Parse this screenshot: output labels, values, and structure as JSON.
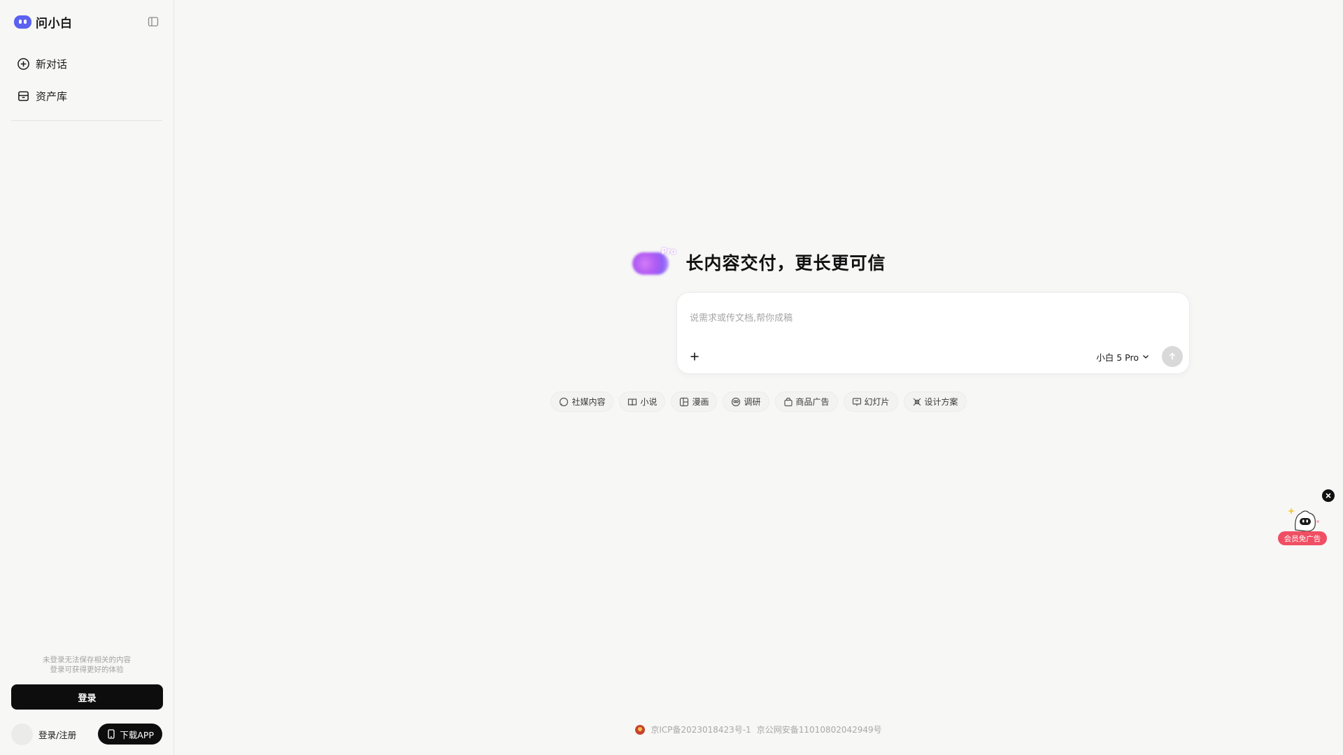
{
  "app": {
    "name": "问小白"
  },
  "sidebar": {
    "items": [
      {
        "label": "新对话",
        "icon": "plus-circle-icon"
      },
      {
        "label": "资产库",
        "icon": "archive-box-icon"
      }
    ],
    "hint_line1": "未登录无法保存相关的内容",
    "hint_line2": "登录可获得更好的体验",
    "login_label": "登录",
    "account_label": "登录/注册",
    "download_label": "下载APP"
  },
  "hero": {
    "badge": "Pro",
    "title": "长内容交付，更长更可信"
  },
  "composer": {
    "placeholder": "说需求或传文档,帮你成稿",
    "value": "",
    "model_label": "小白 5 Pro"
  },
  "chips": [
    {
      "label": "社媒内容",
      "icon": "chat-bubble-icon"
    },
    {
      "label": "小说",
      "icon": "book-icon"
    },
    {
      "label": "漫画",
      "icon": "comic-panels-icon"
    },
    {
      "label": "调研",
      "icon": "research-icon"
    },
    {
      "label": "商品广告",
      "icon": "shopping-bag-icon"
    },
    {
      "label": "幻灯片",
      "icon": "presentation-icon"
    },
    {
      "label": "设计方案",
      "icon": "design-tools-icon"
    }
  ],
  "footer": {
    "icp": "京ICP备2023018423号-1",
    "police": "京公网安备11010802042949号"
  },
  "ad": {
    "badge": "会员免广告"
  },
  "colors": {
    "brand": "#5b62f0",
    "primary_button": "#0d0d0d",
    "ad_badge": "#f04f63",
    "background": "#f7f7f6"
  }
}
